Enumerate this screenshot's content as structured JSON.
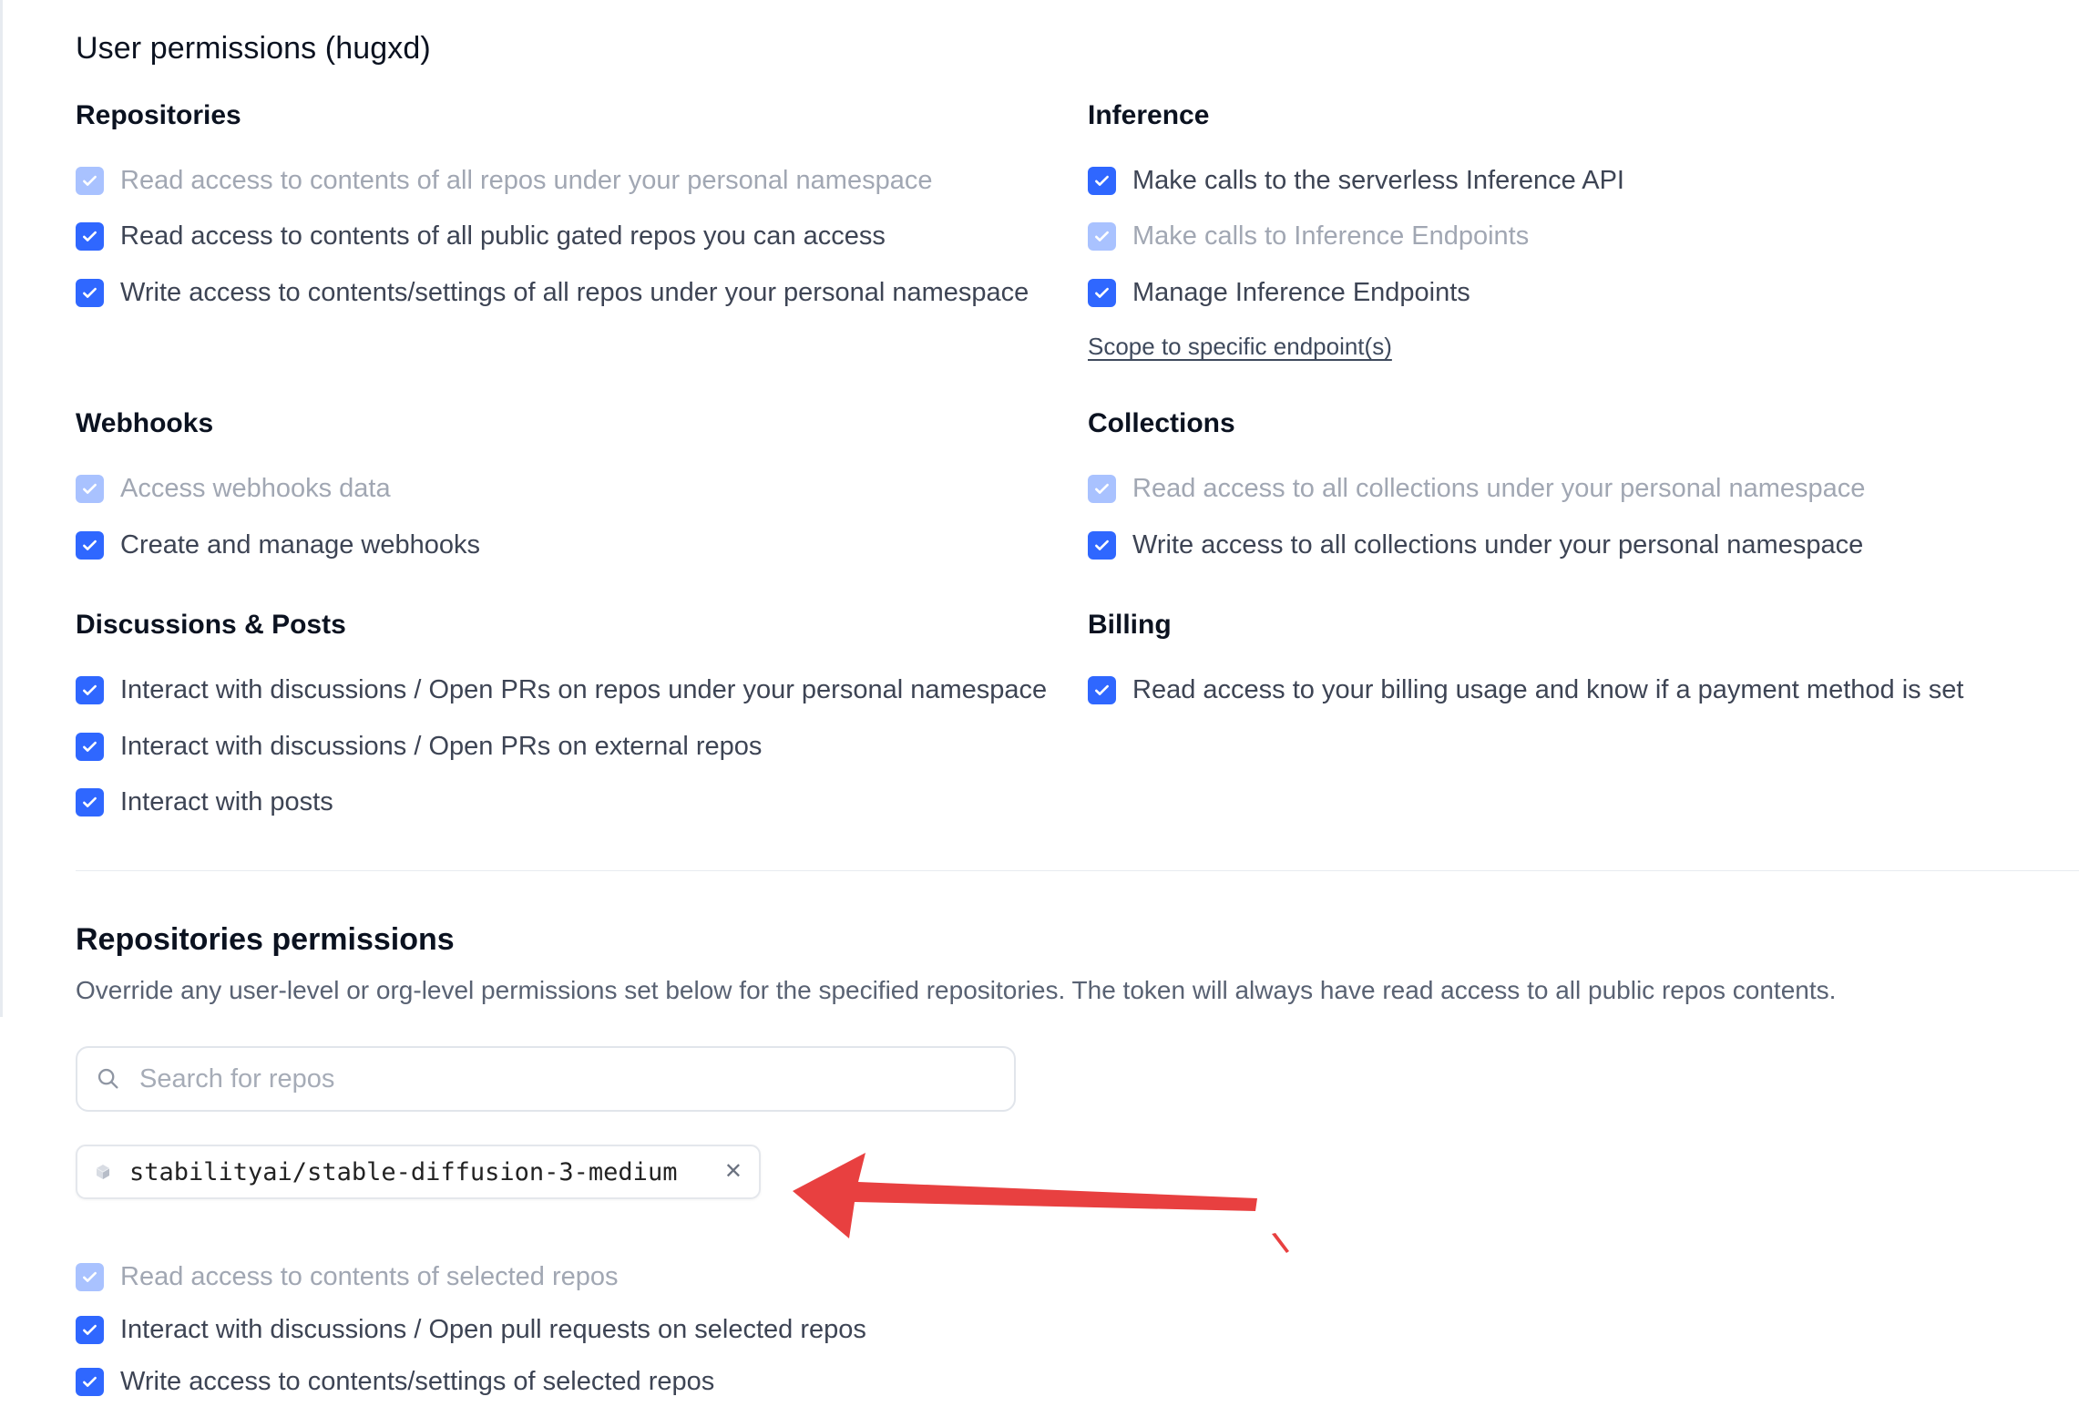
{
  "page_title": "User permissions (hugxd)",
  "sections": {
    "repositories": {
      "title": "Repositories",
      "items": [
        {
          "label": "Read access to contents of all repos under your personal namespace",
          "state": "checked-disabled"
        },
        {
          "label": "Read access to contents of all public gated repos you can access",
          "state": "checked"
        },
        {
          "label": "Write access to contents/settings of all repos under your personal namespace",
          "state": "checked"
        }
      ]
    },
    "inference": {
      "title": "Inference",
      "items": [
        {
          "label": "Make calls to the serverless Inference API",
          "state": "checked"
        },
        {
          "label": "Make calls to Inference Endpoints",
          "state": "checked-disabled"
        },
        {
          "label": "Manage Inference Endpoints",
          "state": "checked"
        }
      ],
      "link": "Scope to specific endpoint(s)"
    },
    "webhooks": {
      "title": "Webhooks",
      "items": [
        {
          "label": "Access webhooks data",
          "state": "checked-disabled"
        },
        {
          "label": "Create and manage webhooks",
          "state": "checked"
        }
      ]
    },
    "collections": {
      "title": "Collections",
      "items": [
        {
          "label": "Read access to all collections under your personal namespace",
          "state": "checked-disabled"
        },
        {
          "label": "Write access to all collections under your personal namespace",
          "state": "checked"
        }
      ]
    },
    "discussions": {
      "title": "Discussions & Posts",
      "items": [
        {
          "label": "Interact with discussions / Open PRs on repos under your personal namespace",
          "state": "checked"
        },
        {
          "label": "Interact with discussions / Open PRs on external repos",
          "state": "checked"
        },
        {
          "label": "Interact with posts",
          "state": "checked"
        }
      ]
    },
    "billing": {
      "title": "Billing",
      "items": [
        {
          "label": "Read access to your billing usage and know if a payment method is set",
          "state": "checked"
        }
      ]
    }
  },
  "repo_permissions": {
    "title": "Repositories permissions",
    "description": "Override any user-level or org-level permissions set below for the specified repositories. The token will always have read access to all public repos contents.",
    "search_placeholder": "Search for repos",
    "selected_repo": "stabilityai/stable-diffusion-3-medium",
    "items": [
      {
        "label": "Read access to contents of selected repos",
        "state": "checked-disabled"
      },
      {
        "label": "Interact with discussions / Open pull requests on selected repos",
        "state": "checked"
      },
      {
        "label": "Write access to contents/settings of selected repos",
        "state": "checked"
      }
    ]
  },
  "colors": {
    "checkbox_checked": "#2f67ff",
    "checkbox_disabled": "#a9c2ff",
    "annotation_arrow": "#e84040"
  }
}
